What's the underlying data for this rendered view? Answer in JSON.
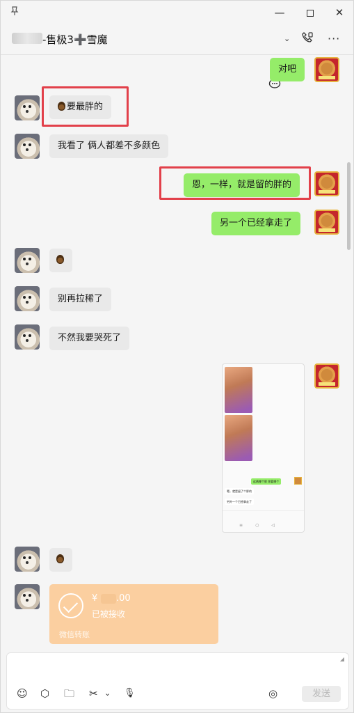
{
  "titlebar": {
    "pin_icon": "pin-icon",
    "minimize": "—",
    "close": "✕"
  },
  "header": {
    "title": "-售极3➕雪魔",
    "chat_icon": "💬",
    "caret": "⌄",
    "call_icon": "📞",
    "more": "···"
  },
  "messages": {
    "m1": "对吧",
    "m2": "要最胖的",
    "m3": "我看了 俩人都差不多颜色",
    "m4": "恩，一样，就是留的胖的",
    "m5": "另一个已经拿走了",
    "m7": "别再拉稀了",
    "m8": "不然我要哭死了"
  },
  "screenshot": {
    "green_msg": "这俩哪个胖 你要哪个",
    "white_msg1": "嗯，就是留了个胖的",
    "white_msg2": "另外一个已经拿走了"
  },
  "transfer": {
    "currency": "¥",
    "amount_suffix": ".00",
    "status": "已被接收",
    "footer": "微信转账"
  },
  "toolbar": {
    "emoji": "☺",
    "box": "⬡",
    "folder": "🗀",
    "scissors": "✂",
    "caret": "⌄",
    "mic": "🎙",
    "voice": "◎",
    "send_label": "发送"
  },
  "colors": {
    "outgoing_bubble": "#95ec69",
    "incoming_bubble": "#e9e9e9",
    "highlight_box": "#e2404a",
    "transfer_card": "#fbcfa0"
  }
}
